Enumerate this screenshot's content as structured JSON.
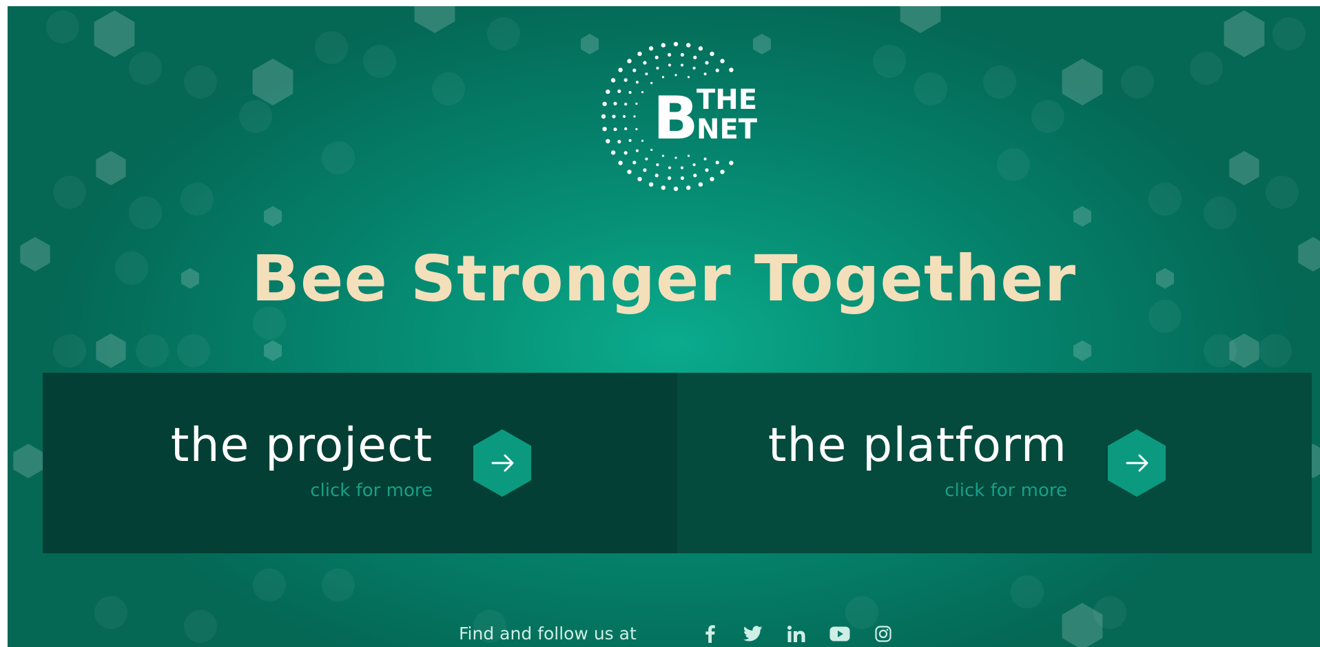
{
  "colors": {
    "background": "#07937a",
    "headline": "#f3dfba",
    "panel_left": "#033f34",
    "panel_right": "#044a3d",
    "accent": "#0b9a80",
    "subtext": "#17a088"
  },
  "logo": {
    "line1": "THE",
    "line2": "NET",
    "letter": "B"
  },
  "headline": "Bee Stronger Together",
  "panels": [
    {
      "title": "the project",
      "subtitle": "click for more",
      "icon": "arrow-right-icon"
    },
    {
      "title": "the platform",
      "subtitle": "click for more",
      "icon": "arrow-right-icon"
    }
  ],
  "footer": {
    "text": "Find and follow us at",
    "social": [
      "facebook-icon",
      "twitter-icon",
      "linkedin-icon",
      "youtube-icon",
      "instagram-icon"
    ]
  }
}
